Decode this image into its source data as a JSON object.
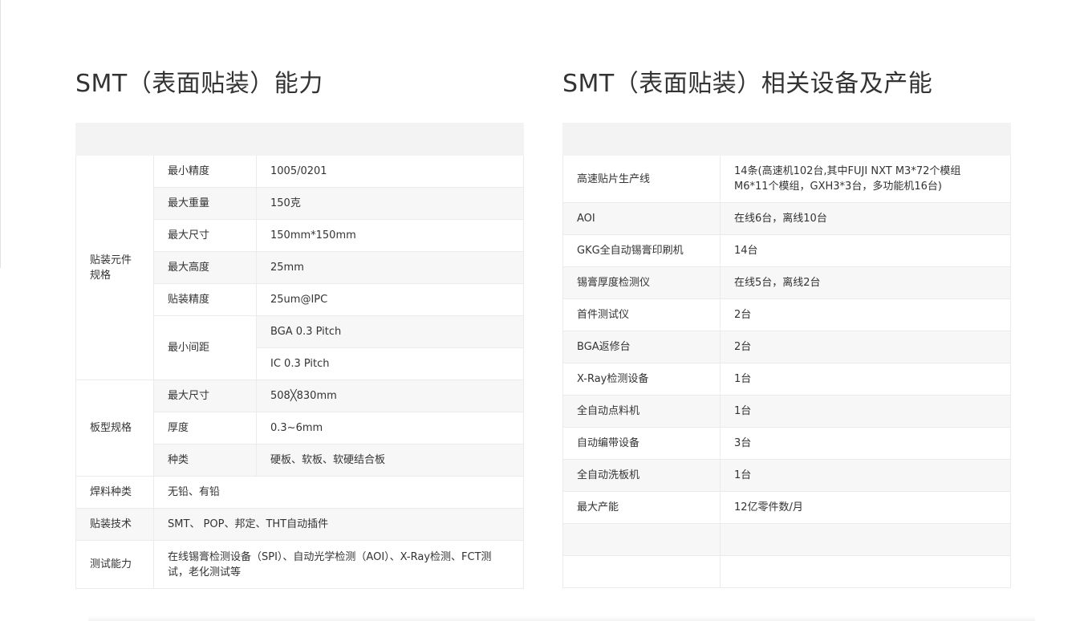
{
  "left_section": {
    "title": "SMT（表面贴装）能力",
    "groups": {
      "component": "贴装元件规格",
      "board": "板型规格"
    },
    "rows": {
      "min_precision": {
        "label": "最小精度",
        "value": "1005/0201"
      },
      "max_weight": {
        "label": "最大重量",
        "value": "150克"
      },
      "max_size": {
        "label": "最大尺寸",
        "value": "150mm*150mm"
      },
      "max_height": {
        "label": "最大高度",
        "value": "25mm"
      },
      "placement_precision": {
        "label": "贴装精度",
        "value": "25um@IPC"
      },
      "min_pitch": {
        "label": "最小间距",
        "values": [
          "BGA 0.3 Pitch",
          "IC 0.3 Pitch"
        ]
      },
      "board_max_size": {
        "label": "最大尺寸",
        "value": "508╳830mm"
      },
      "thickness": {
        "label": "厚度",
        "value": "0.3~6mm"
      },
      "type": {
        "label": "种类",
        "value": "硬板、软板、软硬结合板"
      },
      "solder": {
        "label": "焊料种类",
        "value": "无铅、有铅"
      },
      "technique": {
        "label": "贴装技术",
        "value": "SMT、 POP、邦定、THT自动插件"
      },
      "testing": {
        "label": "测试能力",
        "value": "在线锡膏检测设备（SPI）、自动光学检测（AOI）、X-Ray检测、FCT测试，老化测试等"
      }
    }
  },
  "right_section": {
    "title": "SMT（表面贴装）相关设备及产能",
    "rows": [
      {
        "label": "高速贴片生产线",
        "value": "14条(高速机102台,其中FUJI NXT M3*72个模组 M6*11个模组，GXH3*3台，多功能机16台)"
      },
      {
        "label": "AOI",
        "value": "在线6台，离线10台"
      },
      {
        "label": "GKG全自动锡膏印刷机",
        "value": "14台"
      },
      {
        "label": "锡膏厚度检测仪",
        "value": "在线5台，离线2台"
      },
      {
        "label": "首件测试仪",
        "value": "2台"
      },
      {
        "label": "BGA返修台",
        "value": "2台"
      },
      {
        "label": "X-Ray检测设备",
        "value": "1台"
      },
      {
        "label": "全自动点料机",
        "value": "1台"
      },
      {
        "label": "自动编带设备",
        "value": "3台"
      },
      {
        "label": "全自动洗板机",
        "value": "1台"
      },
      {
        "label": "最大产能",
        "value": "12亿零件数/月"
      }
    ]
  }
}
